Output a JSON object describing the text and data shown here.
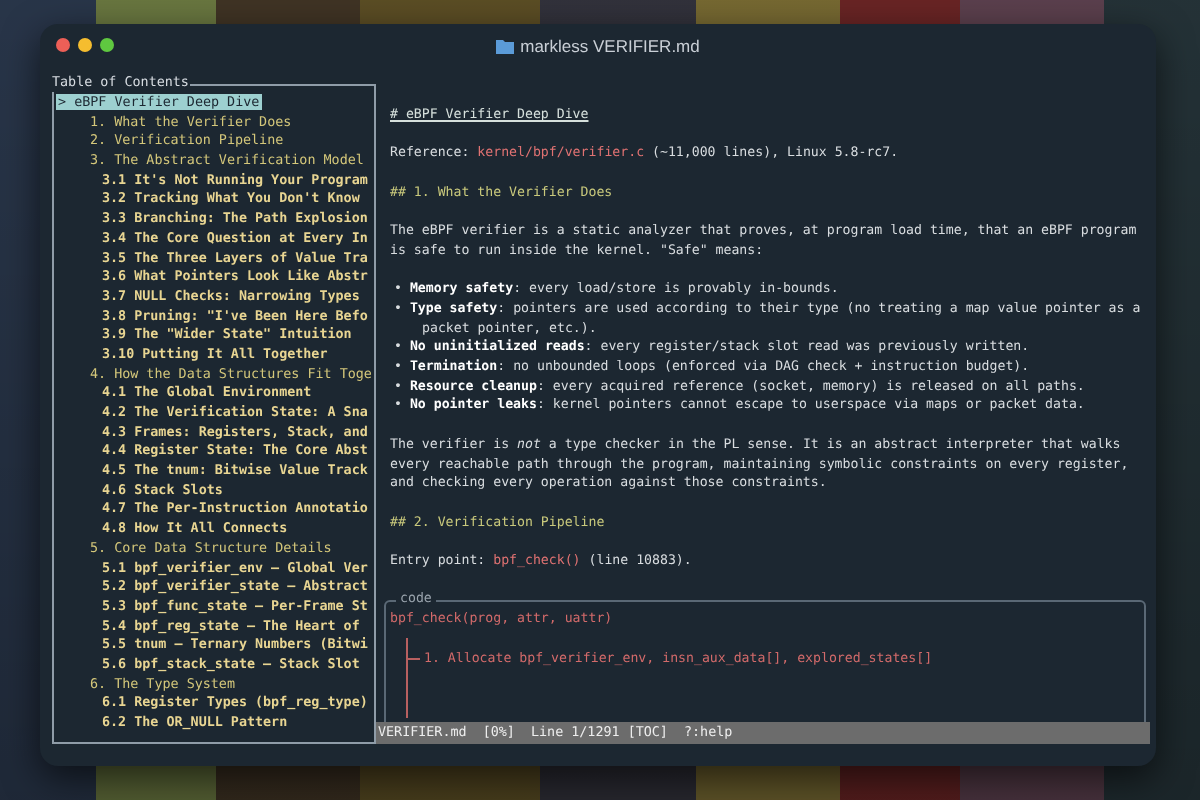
{
  "window": {
    "title": "markless VERIFIER.md"
  },
  "toc": {
    "title": "Table of Contents",
    "cursor": ">",
    "items": [
      {
        "label": "eBPF Verifier Deep Dive",
        "selected": true,
        "children": [
          {
            "label": "1. What the Verifier Does",
            "selected": false
          },
          {
            "label": "2. Verification Pipeline",
            "selected": false
          },
          {
            "label": "3. The Abstract Verification Model",
            "selected": false,
            "children": [
              {
                "label": "3.1 It's Not Running Your Program",
                "selected": false
              },
              {
                "label": "3.2 Tracking What You Don't Know",
                "selected": false
              },
              {
                "label": "3.3 Branching: The Path Explosion",
                "selected": false
              },
              {
                "label": "3.4 The Core Question at Every In",
                "selected": false
              },
              {
                "label": "3.5 The Three Layers of Value Tra",
                "selected": false
              },
              {
                "label": "3.6 What Pointers Look Like Abstr",
                "selected": false
              },
              {
                "label": "3.7 NULL Checks: Narrowing Types",
                "selected": false
              },
              {
                "label": "3.8 Pruning: \"I've Been Here Befo",
                "selected": false
              },
              {
                "label": "3.9 The \"Wider State\" Intuition",
                "selected": false
              },
              {
                "label": "3.10 Putting It All Together",
                "selected": false
              }
            ]
          },
          {
            "label": "4. How the Data Structures Fit Toge",
            "selected": false,
            "children": [
              {
                "label": "4.1 The Global Environment",
                "selected": false
              },
              {
                "label": "4.2 The Verification State: A Sna",
                "selected": false
              },
              {
                "label": "4.3 Frames: Registers, Stack, and",
                "selected": false
              },
              {
                "label": "4.4 Register State: The Core Abst",
                "selected": false
              },
              {
                "label": "4.5 The tnum: Bitwise Value Track",
                "selected": false
              },
              {
                "label": "4.6 Stack Slots",
                "selected": false
              },
              {
                "label": "4.7 The Per-Instruction Annotatio",
                "selected": false
              },
              {
                "label": "4.8 How It All Connects",
                "selected": false
              }
            ]
          },
          {
            "label": "5. Core Data Structure Details",
            "selected": false,
            "children": [
              {
                "label": "5.1 bpf_verifier_env — Global Ver",
                "selected": false
              },
              {
                "label": "5.2 bpf_verifier_state — Abstract",
                "selected": false
              },
              {
                "label": "5.3 bpf_func_state — Per-Frame St",
                "selected": false
              },
              {
                "label": "5.4 bpf_reg_state — The Heart of",
                "selected": false
              },
              {
                "label": "5.5 tnum — Ternary Numbers (Bitwi",
                "selected": false
              },
              {
                "label": "5.6 bpf_stack_state — Stack Slot",
                "selected": false
              }
            ]
          },
          {
            "label": "6. The Type System",
            "selected": false,
            "children": [
              {
                "label": "6.1 Register Types (bpf_reg_type)",
                "selected": false
              },
              {
                "label": "6.2 The OR_NULL Pattern",
                "selected": false
              }
            ]
          }
        ]
      }
    ]
  },
  "document": {
    "blocks": [
      {
        "kind": "h1",
        "text": "# eBPF Verifier Deep Dive"
      },
      {
        "kind": "paragraph",
        "segments": [
          {
            "kind": "text",
            "text": "Reference: "
          },
          {
            "kind": "code",
            "text": "kernel/bpf/verifier.c"
          },
          {
            "kind": "text",
            "text": " (~11,000 lines), Linux 5.8-rc7."
          }
        ]
      },
      {
        "kind": "h2",
        "text": "## 1. What the Verifier Does"
      },
      {
        "kind": "paragraph",
        "segments": [
          {
            "kind": "text",
            "text": "The eBPF verifier is a static analyzer that proves, at program load time, that an eBPF program is safe to run inside the kernel. \"Safe\" means:"
          }
        ]
      },
      {
        "kind": "list",
        "items": [
          "• **Memory safety**: every load/store is provably in-bounds.",
          "• **Type safety**: pointers are used according to their type (no treating a map value pointer as a packet pointer, etc.).",
          "• **No uninitialized reads**: every register/stack slot read was previously written.",
          "• **Termination**: no unbounded loops (enforced via DAG check + instruction budget).",
          "• **Resource cleanup**: every acquired reference (socket, memory) is released on all paths.",
          "• **No pointer leaks**: kernel pointers cannot escape to userspace via maps or packet data."
        ]
      },
      {
        "kind": "paragraph",
        "segments": [
          {
            "kind": "text",
            "text": "The verifier is *not* a type checker in the PL sense. It is an abstract interpreter that walks every reachable path through the program, maintaining symbolic constraints on every register, and checking every operation against those constraints."
          }
        ]
      },
      {
        "kind": "h2",
        "text": "## 2. Verification Pipeline"
      },
      {
        "kind": "paragraph",
        "segments": [
          {
            "kind": "text",
            "text": "Entry point: "
          },
          {
            "kind": "code",
            "text": "bpf_check()"
          },
          {
            "kind": "text",
            "text": " (line 10883)."
          }
        ]
      },
      {
        "kind": "code",
        "label": "code",
        "lines": [
          {
            "kind": "call",
            "text": "bpf_check(prog, attr, uattr)"
          },
          {
            "kind": "branch",
            "text": "1. Allocate bpf_verifier_env, insn_aux_data[], explored_states[]"
          }
        ]
      }
    ]
  },
  "status_bar": {
    "text": "VERIFIER.md  [0%]  Line 1/1291 [TOC]  ?:help"
  }
}
